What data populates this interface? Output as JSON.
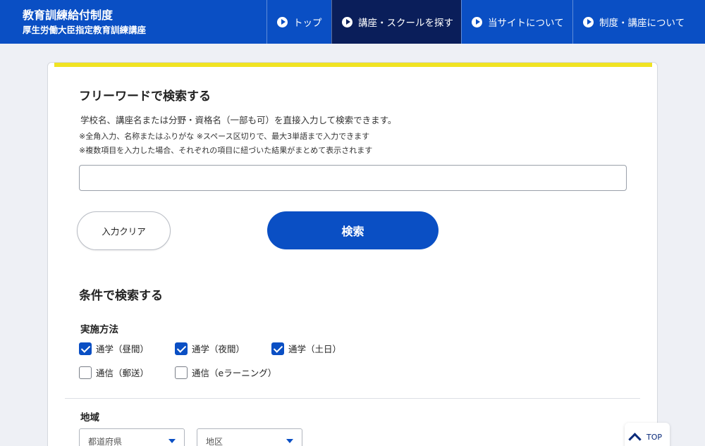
{
  "header": {
    "title_line1": "教育訓練給付制度",
    "title_line2": "厚生労働大臣指定教育訓練講座",
    "nav": [
      {
        "label": "トップ",
        "active": false
      },
      {
        "label": "講座・スクールを探す",
        "active": true
      },
      {
        "label": "当サイトについて",
        "active": false
      },
      {
        "label": "制度・講座について",
        "active": false
      }
    ]
  },
  "keyword_search": {
    "heading": "フリーワードで検索する",
    "description": "学校名、講座名または分野・資格名（一部も可）を直接入力して検索できます。",
    "note1": "※全角入力、名称またはふりがな ※スペース区切りで、最大3単語まで入力できます",
    "note2": "※複数項目を入力した場合、それぞれの項目に紐づいた結果がまとめて表示されます",
    "input_value": "",
    "clear_label": "入力クリア",
    "search_label": "検索"
  },
  "condition_search": {
    "heading": "条件で検索する",
    "method_label": "実施方法",
    "methods": [
      {
        "label": "通学（昼間）",
        "checked": true
      },
      {
        "label": "通学（夜間）",
        "checked": true
      },
      {
        "label": "通学（土日）",
        "checked": true
      },
      {
        "label": "通信（郵送）",
        "checked": false
      },
      {
        "label": "通信（eラーニング）",
        "checked": false
      }
    ],
    "region_label": "地域",
    "prefecture_placeholder": "都道府県",
    "district_placeholder": "地区"
  },
  "back_to_top_label": "TOP",
  "colors": {
    "primary": "#0a4fc4",
    "nav_active": "#0a1e5a",
    "accent_bar": "#f0e322"
  }
}
